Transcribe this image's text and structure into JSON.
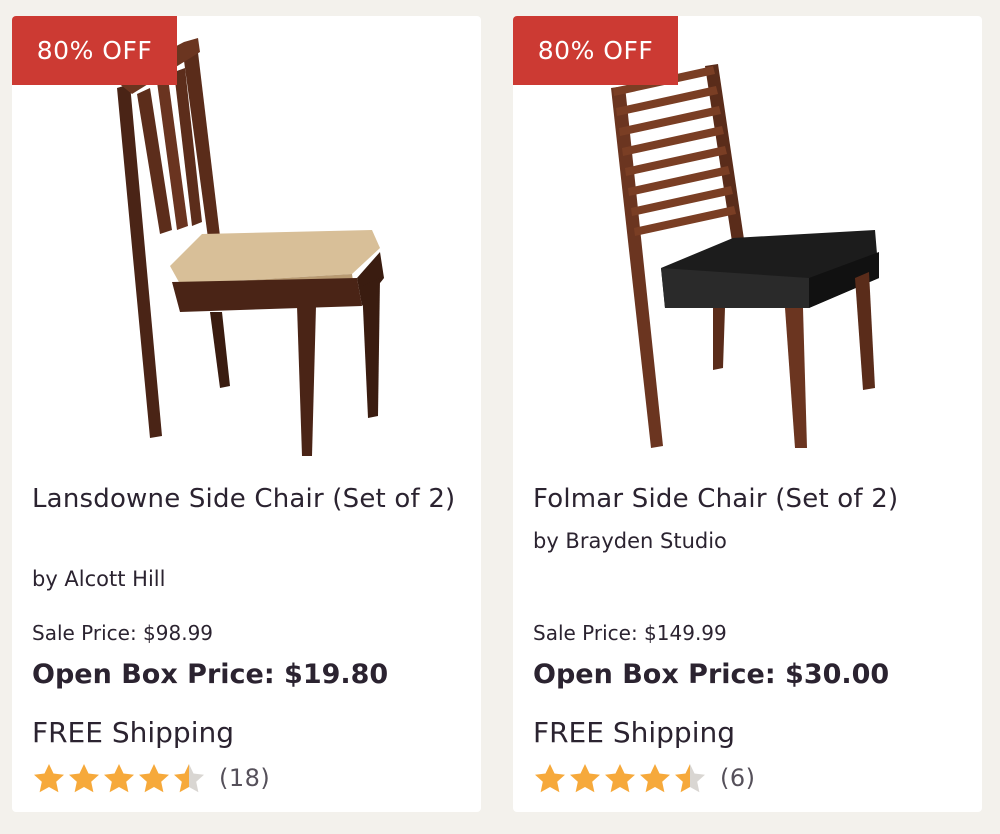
{
  "colors": {
    "badge_bg": "#cc3a33",
    "star_fill": "#f6a93b",
    "star_empty": "#d9d6d2",
    "page_bg": "#f3f1ec"
  },
  "products": [
    {
      "badge": "80% OFF",
      "image_icon": "chair-image",
      "title": "Lansdowne Side Chair (Set of 2)",
      "brand": "by Alcott Hill",
      "sale_price": "Sale Price: $98.99",
      "open_box_price": "Open Box Price: $19.80",
      "shipping": "FREE Shipping",
      "rating": 4.5,
      "review_count": "(18)"
    },
    {
      "badge": "80% OFF",
      "image_icon": "chair-image",
      "title": "Folmar Side Chair (Set of 2)",
      "brand": "by Brayden Studio",
      "sale_price": "Sale Price: $149.99",
      "open_box_price": "Open Box Price: $30.00",
      "shipping": "FREE Shipping",
      "rating": 4.5,
      "review_count": "(6)"
    }
  ]
}
